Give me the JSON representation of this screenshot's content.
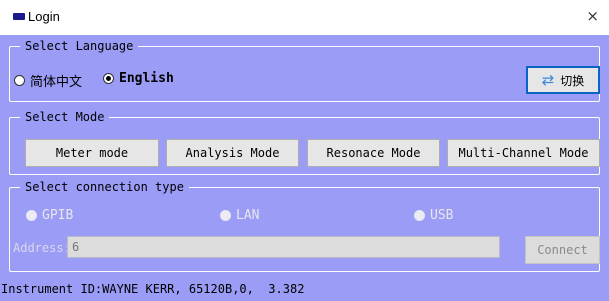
{
  "window": {
    "title": "Login",
    "close_glyph": "×",
    "logo_icon": "app-logo-icon"
  },
  "language": {
    "legend": "Select Language",
    "options": [
      {
        "label": "简体中文",
        "selected": false
      },
      {
        "label": "English",
        "selected": true
      }
    ],
    "switch_button": {
      "label": "切换",
      "icon": "swap-arrows-icon"
    }
  },
  "mode": {
    "legend": "Select Mode",
    "buttons": [
      "Meter mode",
      "Analysis Mode",
      "Resonace Mode",
      "Multi-Channel Mode"
    ]
  },
  "connection": {
    "legend": "Select connection type",
    "options": [
      {
        "label": "GPIB",
        "selected": true,
        "enabled": false
      },
      {
        "label": "LAN",
        "selected": false,
        "enabled": false
      },
      {
        "label": "USB",
        "selected": false,
        "enabled": false
      }
    ],
    "address_label": "Address:",
    "address_value": "6",
    "connect_label": "Connect"
  },
  "status": {
    "text": "Instrument ID:WAYNE KERR, 65120B,0,  3.382"
  },
  "colors": {
    "background": "#9a9cf6",
    "titlebar": "#ffffff",
    "accent": "#0a64c8"
  }
}
